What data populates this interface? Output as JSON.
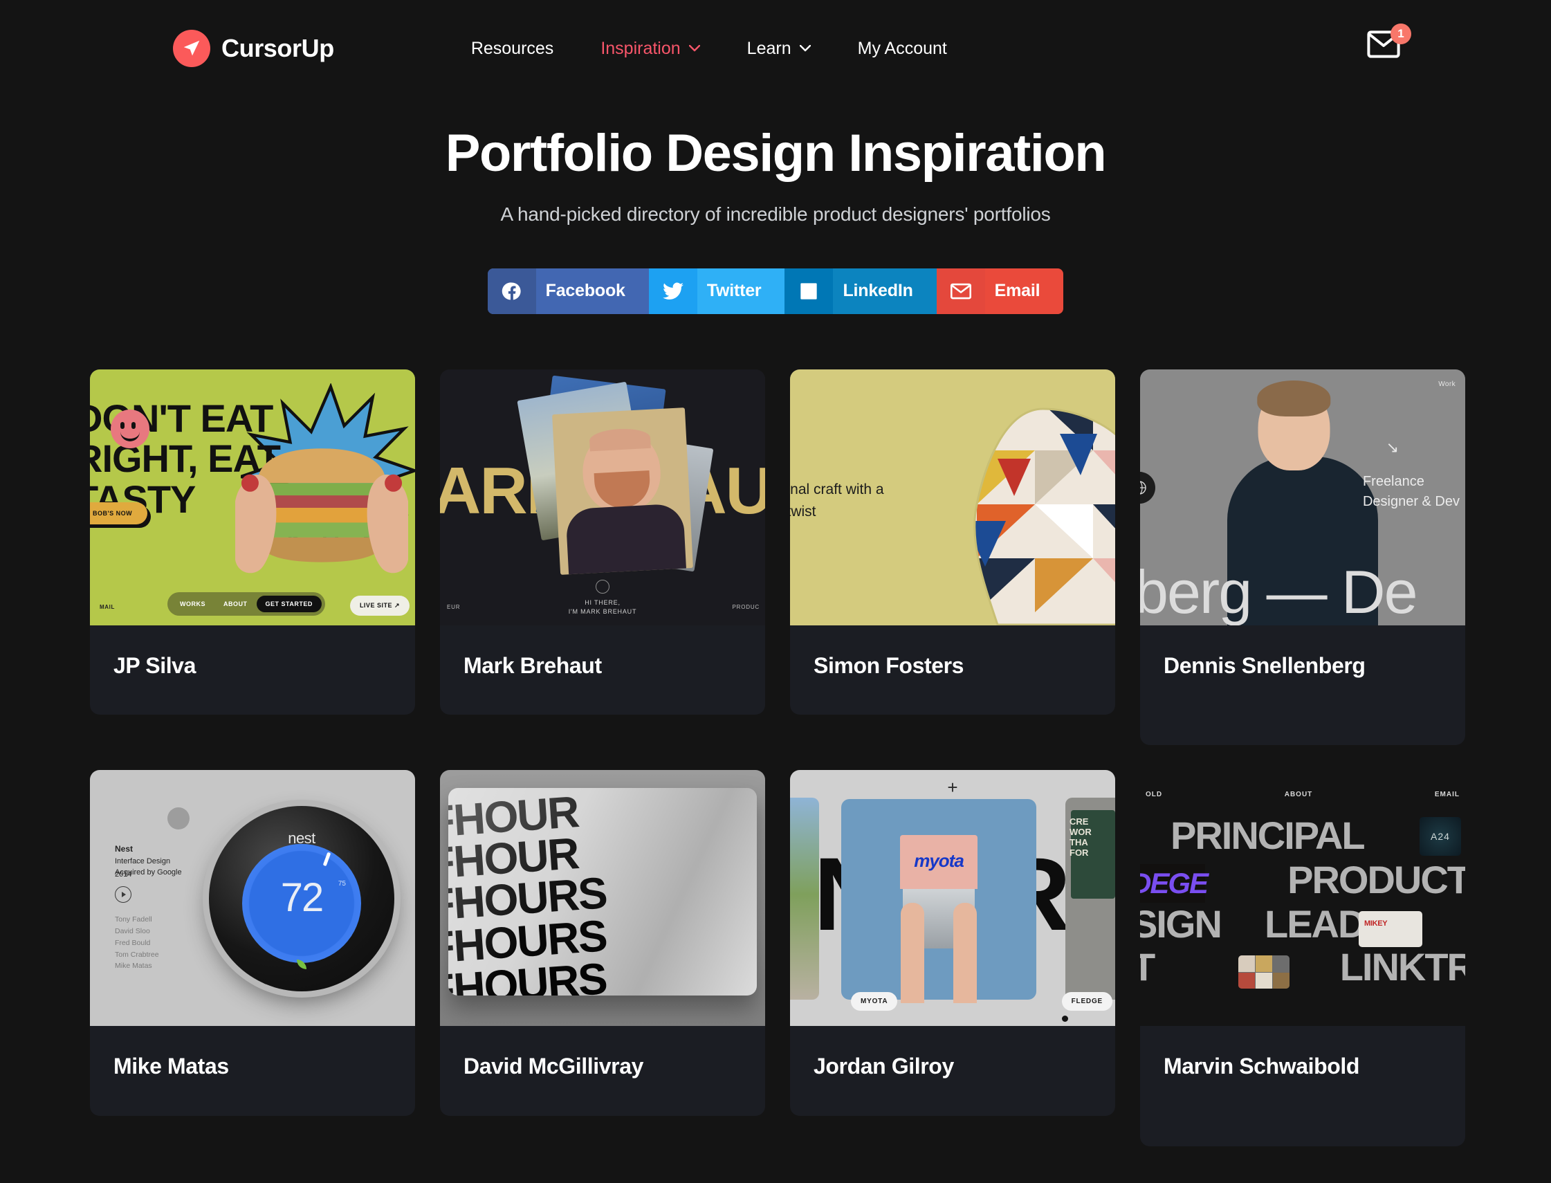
{
  "brand": {
    "name": "CursorUp",
    "logo_color": "#fb5a5a",
    "icon": "cursor-arrow-icon"
  },
  "nav": {
    "items": [
      {
        "label": "Resources",
        "has_chevron": false,
        "active": false
      },
      {
        "label": "Inspiration",
        "has_chevron": true,
        "active": true
      },
      {
        "label": "Learn",
        "has_chevron": true,
        "active": false
      },
      {
        "label": "My Account",
        "has_chevron": false,
        "active": false
      }
    ],
    "mail": {
      "icon": "envelope-icon",
      "badge": "1",
      "badge_color": "#f8776a"
    },
    "active_color": "#f8566a"
  },
  "hero": {
    "title": "Portfolio Design Inspiration",
    "subtitle": "A hand-picked directory of incredible product designers' portfolios"
  },
  "share": [
    {
      "label": "Facebook",
      "icon": "facebook-icon",
      "icon_bg": "#3b5998",
      "label_bg": "#4267b2"
    },
    {
      "label": "Twitter",
      "icon": "twitter-icon",
      "icon_bg": "#1da1f2",
      "label_bg": "#2fb0f6"
    },
    {
      "label": "LinkedIn",
      "icon": "linkedin-icon",
      "icon_bg": "#0077b5",
      "label_bg": "#0c84bf"
    },
    {
      "label": "Email",
      "icon": "email-icon",
      "icon_bg": "#e4483c",
      "label_bg": "#ea4a3b"
    }
  ],
  "cards": [
    {
      "name": "JP Silva",
      "thumb": {
        "bg": "#b5c84a",
        "headline": "DON'T EAT\nRIGHT, EAT\nTASTY",
        "cta": "BOB'S NOW",
        "nav": [
          "WORKS",
          "ABOUT",
          "GET STARTED"
        ],
        "live": "LIVE SITE ↗",
        "mail_label": "MAIL"
      }
    },
    {
      "name": "Mark Brehaut",
      "thumb": {
        "bg": "#1a1a1f",
        "word_left": "ARK",
        "word_right": "AU",
        "caption_line1": "HI THERE,",
        "caption_line2": "I'M MARK BREHAUT",
        "corner_left": "EUR",
        "corner_right": "PRODUC"
      }
    },
    {
      "name": "Simon Fosters",
      "thumb": {
        "bg": "#d4cb7e",
        "text_line1": "tional craft with a",
        "text_line2": "n twist"
      }
    },
    {
      "name": "Dennis Snellenberg",
      "thumb": {
        "bg": "#8a8a8a",
        "nav_label": "Work",
        "role_line1": "Freelance",
        "role_line2": "Designer & Dev",
        "bigname": "berg — De"
      }
    },
    {
      "name": "Mike Matas",
      "thumb": {
        "bg": "#c6c6c6",
        "project": "Nest",
        "project_role": "Interface Design",
        "project_note": "Acquired by Google",
        "year": "2014",
        "device_brand": "nest",
        "temperature": "72",
        "temp_mark": "75",
        "credits": [
          "Tony Fadell",
          "David Sloo",
          "Fred Bould",
          "Tom Crabtree",
          "Mike Matas"
        ]
      }
    },
    {
      "name": "David McGillivray",
      "thumb": {
        "bg": "#8e8e8e",
        "lines": [
          "FHOUR",
          "FHOUR",
          "FHOURS",
          "FHOURS",
          "FHOURS"
        ]
      }
    },
    {
      "name": "Jordan Gilroy",
      "thumb": {
        "bg": "#d0d0d0",
        "letter_left": "N",
        "letter_right": "R",
        "product": "MYOTA",
        "tag_left": "MYOTA",
        "tag_right": "FLEDGE",
        "billboard_text": "CRE\nWOR\nTHA\nFOR",
        "plus": "+"
      }
    },
    {
      "name": "Marvin Schwaibold",
      "thumb": {
        "bg": "#141414",
        "nav": [
          "OLD",
          "ABOUT",
          "EMAIL"
        ],
        "word1": "PRINCIPAL",
        "word2": "PRODUCT",
        "word3": "SIGN",
        "word4": "LEAD",
        "word5": "T",
        "word6": "LINKTR",
        "badge_purple": "DEGE",
        "thumb_a24": "A24",
        "thumb_mk": "MIKEY"
      }
    }
  ]
}
